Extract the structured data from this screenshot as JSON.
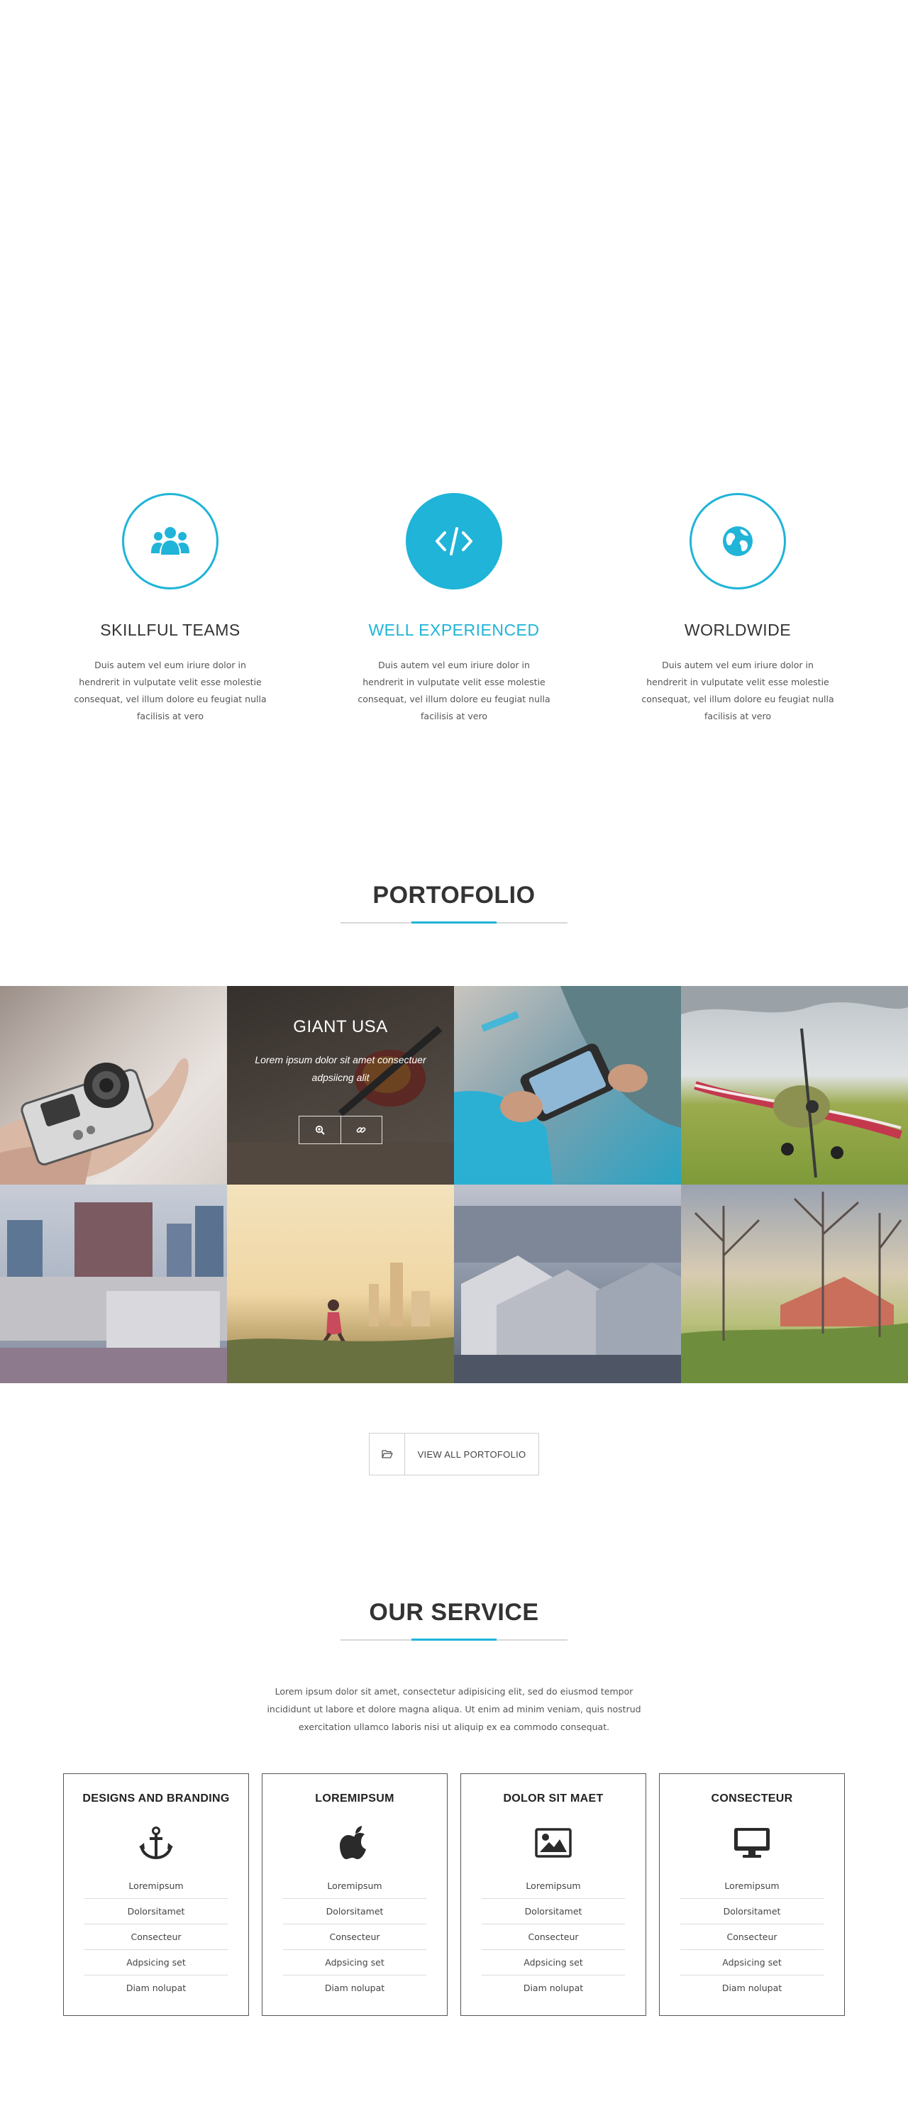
{
  "colors": {
    "accent": "#1fb4d8",
    "text": "#333333"
  },
  "features": [
    {
      "title": "SKILLFUL TEAMS",
      "text": "Duis autem vel eum iriure dolor in hendrerit in vulputate velit esse molestie consequat, vel illum dolore eu feugiat nulla facilisis at vero",
      "icon": "users-icon"
    },
    {
      "title": "WELL EXPERIENCED",
      "text": "Duis autem vel eum iriure dolor in hendrerit in vulputate velit esse molestie consequat, vel illum dolore eu feugiat nulla facilisis at vero",
      "icon": "code-icon"
    },
    {
      "title": "WORLDWIDE",
      "text": "Duis autem vel eum iriure dolor in hendrerit in vulputate velit esse molestie consequat, vel illum dolore eu feugiat nulla facilisis at vero",
      "icon": "globe-icon"
    }
  ],
  "portfolio": {
    "title": "PORTOFOLIO",
    "overlay": {
      "title": "GIANT USA",
      "desc": "Lorem ipsum dolor sit amet consectuer adpsiicng alit"
    },
    "view_all": "VIEW ALL PORTOFOLIO"
  },
  "service": {
    "title": "OUR SERVICE",
    "intro": "Lorem ipsum dolor sit amet, consectetur adipisicing elit, sed do eiusmod tempor incididunt ut labore et dolore magna aliqua. Ut enim ad minim veniam, quis nostrud exercitation ullamco laboris nisi ut aliquip ex ea commodo consequat.",
    "cards": [
      {
        "title": "DESIGNS AND BRANDING",
        "icon": "anchor-icon",
        "items": [
          "Loremipsum",
          "Dolorsitamet",
          "Consecteur",
          "Adpsicing set",
          "Diam nolupat"
        ]
      },
      {
        "title": "LOREMIPSUM",
        "icon": "apple-icon",
        "items": [
          "Loremipsum",
          "Dolorsitamet",
          "Consecteur",
          "Adpsicing set",
          "Diam nolupat"
        ]
      },
      {
        "title": "DOLOR SIT MAET",
        "icon": "image-icon",
        "items": [
          "Loremipsum",
          "Dolorsitamet",
          "Consecteur",
          "Adpsicing set",
          "Diam nolupat"
        ]
      },
      {
        "title": "CONSECTEUR",
        "icon": "monitor-icon",
        "items": [
          "Loremipsum",
          "Dolorsitamet",
          "Consecteur",
          "Adpsicing set",
          "Diam nolupat"
        ]
      }
    ]
  }
}
